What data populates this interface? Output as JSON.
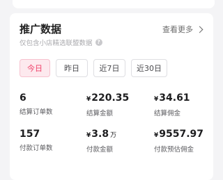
{
  "section": {
    "title": "推广数据",
    "more_label": "查看更多",
    "subtitle": "仅包含小店精选联盟数据",
    "help_icon_glyph": "?"
  },
  "tabs": [
    {
      "label": "今日",
      "active": true
    },
    {
      "label": "昨日",
      "active": false
    },
    {
      "label": "近7日",
      "active": false
    },
    {
      "label": "近30日",
      "active": false
    }
  ],
  "metrics": {
    "settled_orders": {
      "value": "6",
      "label": "结算订单数"
    },
    "settled_amount": {
      "currency": "¥",
      "value": "220.35",
      "label": "结算金额"
    },
    "settled_commission": {
      "currency": "¥",
      "value": "34.61",
      "label": "结算佣金"
    },
    "paid_orders": {
      "value": "157",
      "label": "付款订单数"
    },
    "paid_amount": {
      "currency": "¥",
      "value": "3.8",
      "unit": "万",
      "label": "付款金额"
    },
    "est_commission": {
      "currency": "¥",
      "value": "9557.97",
      "label": "付款预估佣金"
    }
  },
  "colors": {
    "accent": "#f0426a",
    "accent_bg": "#fde9ee",
    "page_bg": "#f4f4f6"
  }
}
